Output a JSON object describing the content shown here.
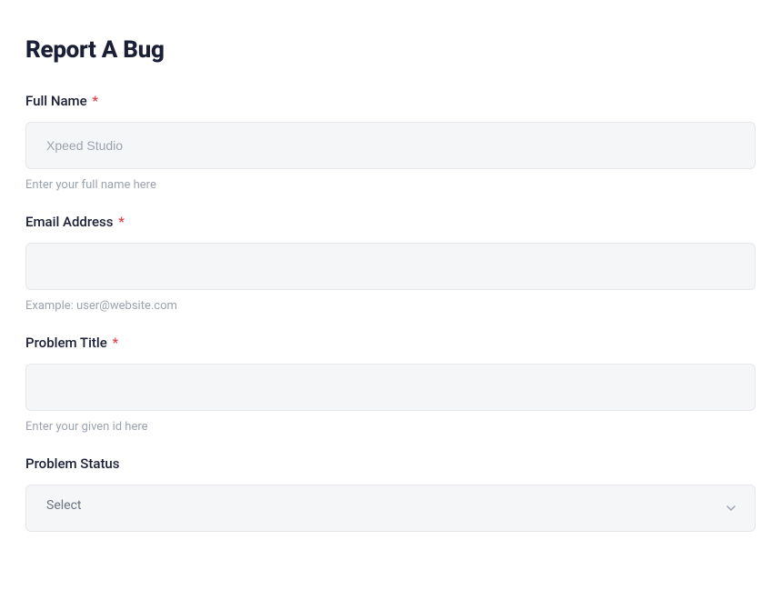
{
  "form": {
    "title": "Report A Bug",
    "fields": {
      "fullName": {
        "label": "Full Name",
        "required": true,
        "placeholder": "Xpeed Studio",
        "value": "",
        "help": "Enter your full name here"
      },
      "email": {
        "label": "Email Address",
        "required": true,
        "placeholder": "",
        "value": "",
        "help": "Example: user@website.com"
      },
      "problemTitle": {
        "label": "Problem Title",
        "required": true,
        "placeholder": "",
        "value": "",
        "help": "Enter your given id here"
      },
      "problemStatus": {
        "label": "Problem Status",
        "required": false,
        "selected": "Select"
      }
    },
    "requiredMark": "*"
  }
}
